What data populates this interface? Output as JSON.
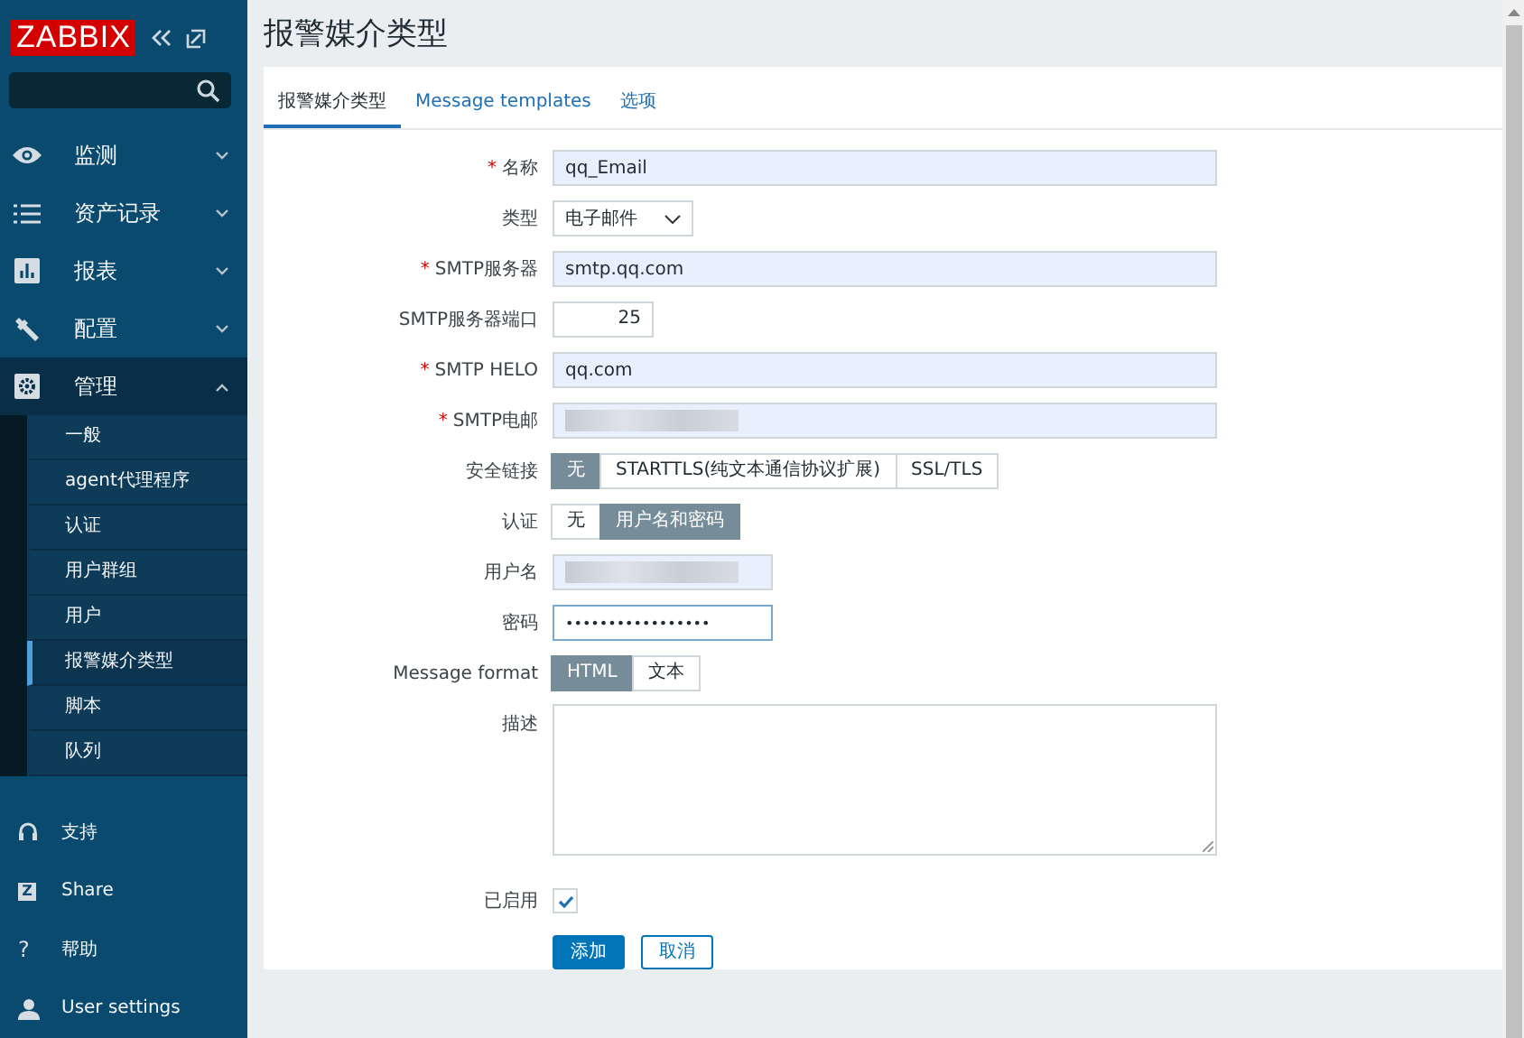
{
  "sidebar": {
    "logo": "ZABBIX",
    "menu": [
      {
        "label": "监测",
        "expanded": false
      },
      {
        "label": "资产记录",
        "expanded": false
      },
      {
        "label": "报表",
        "expanded": false
      },
      {
        "label": "配置",
        "expanded": false
      },
      {
        "label": "管理",
        "expanded": true,
        "children": [
          {
            "label": "一般",
            "selected": false
          },
          {
            "label": "agent代理程序",
            "selected": false
          },
          {
            "label": "认证",
            "selected": false
          },
          {
            "label": "用户群组",
            "selected": false
          },
          {
            "label": "用户",
            "selected": false
          },
          {
            "label": "报警媒介类型",
            "selected": true
          },
          {
            "label": "脚本",
            "selected": false
          },
          {
            "label": "队列",
            "selected": false
          }
        ]
      }
    ],
    "bottom": [
      {
        "label": "支持"
      },
      {
        "label": "Share",
        "glyph": "Z"
      },
      {
        "label": "帮助",
        "glyph": "?"
      },
      {
        "label": "User settings"
      }
    ]
  },
  "page_title": "报警媒介类型",
  "tabs": [
    {
      "label": "报警媒介类型",
      "selected": true
    },
    {
      "label": "Message templates",
      "selected": false
    },
    {
      "label": "选项",
      "selected": false
    }
  ],
  "form": [
    {
      "kind": "text",
      "label": "名称",
      "required_mark": "*",
      "value": "qq_Email"
    },
    {
      "kind": "select",
      "label": "类型",
      "value": "电子邮件"
    },
    {
      "kind": "text",
      "label": "SMTP服务器",
      "required_mark": "*",
      "value": "smtp.qq.com"
    },
    {
      "kind": "number",
      "label": "SMTP服务器端口",
      "value": "25"
    },
    {
      "kind": "text",
      "label": "SMTP HELO",
      "required_mark": "*",
      "value": "qq.com"
    },
    {
      "kind": "text",
      "label": "SMTP电邮",
      "required_mark": "*",
      "redacted": true
    },
    {
      "kind": "segmented",
      "label": "安全链接",
      "options": [
        {
          "label": "无",
          "selected": true
        },
        {
          "label": "STARTTLS(纯文本通信协议扩展)",
          "selected": false
        },
        {
          "label": "SSL/TLS",
          "selected": false
        }
      ]
    },
    {
      "kind": "segmented",
      "label": "认证",
      "options": [
        {
          "label": "无",
          "selected": false
        },
        {
          "label": "用户名和密码",
          "selected": true
        }
      ]
    },
    {
      "kind": "short",
      "label": "用户名",
      "redacted": true
    },
    {
      "kind": "password",
      "label": "密码",
      "value": "•••••••••••••••••"
    },
    {
      "kind": "segmented",
      "label": "Message format",
      "options": [
        {
          "label": "HTML",
          "selected": true
        },
        {
          "label": "文本",
          "selected": false
        }
      ]
    },
    {
      "kind": "textarea",
      "label": "描述"
    },
    {
      "kind": "checkbox",
      "label": "已启用",
      "checked": true
    }
  ],
  "buttons": [
    {
      "label": "添加",
      "primary": true
    },
    {
      "label": "取消",
      "primary": false
    }
  ]
}
